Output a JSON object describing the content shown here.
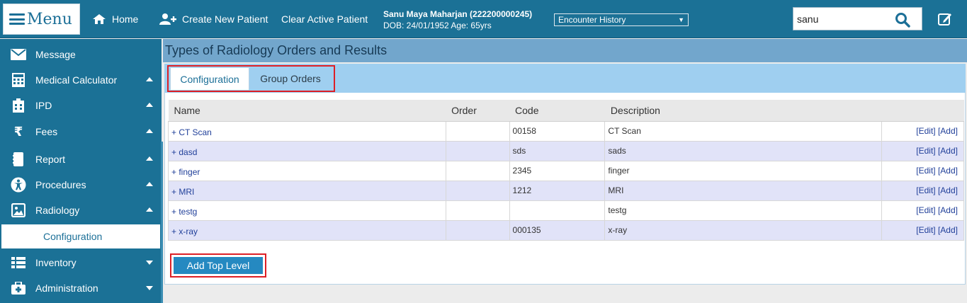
{
  "header": {
    "menu_label": "Menu",
    "nav": [
      {
        "label": "Home",
        "icon": "home-icon"
      },
      {
        "label": "Create New Patient",
        "icon": "add-user-icon"
      },
      {
        "label": "Clear Active Patient"
      }
    ],
    "patient_name": "Sanu Maya Maharjan (222200000245)",
    "patient_details": "DOB: 24/01/1952 Age: 65yrs",
    "encounter_select": "Encounter History",
    "search_value": "sanu"
  },
  "sidebar": {
    "items": [
      {
        "label": "Message",
        "icon": "envelope-icon"
      },
      {
        "label": "Medical Calculator",
        "icon": "calculator-icon"
      },
      {
        "label": "IPD",
        "icon": "hospital-icon"
      },
      {
        "label": "Fees",
        "icon": "rupee-icon"
      },
      {
        "label": "Report",
        "icon": "report-icon"
      },
      {
        "label": "Procedures",
        "icon": "accessibility-icon"
      },
      {
        "label": "Radiology",
        "icon": "image-icon"
      },
      {
        "label": "Inventory",
        "icon": "list-icon"
      },
      {
        "label": "Administration",
        "icon": "medkit-icon"
      }
    ],
    "active_sub_item": "Configuration"
  },
  "page": {
    "title": "Types of Radiology Orders and Results",
    "tabs": [
      "Configuration",
      "Group Orders"
    ],
    "active_tab": "Configuration"
  },
  "table": {
    "columns": [
      "Name",
      "Order",
      "Code",
      "Description",
      ""
    ],
    "rows": [
      {
        "name": "+ CT Scan",
        "order": "",
        "code": "00158",
        "description": "CT Scan",
        "edit": "[Edit]",
        "add": "[Add]"
      },
      {
        "name": "+ dasd",
        "order": "",
        "code": "sds",
        "description": "sads",
        "edit": "[Edit]",
        "add": "[Add]"
      },
      {
        "name": "+ finger",
        "order": "",
        "code": "2345",
        "description": "finger",
        "edit": "[Edit]",
        "add": "[Add]"
      },
      {
        "name": "+ MRI",
        "order": "",
        "code": "1212",
        "description": "MRI",
        "edit": "[Edit]",
        "add": "[Add]"
      },
      {
        "name": "+ testg",
        "order": "",
        "code": "",
        "description": "testg",
        "edit": "[Edit]",
        "add": "[Add]"
      },
      {
        "name": "+ x-ray",
        "order": "",
        "code": "000135",
        "description": "x-ray",
        "edit": "[Edit]",
        "add": "[Add]"
      }
    ]
  },
  "add_top_level_label": "Add Top Level",
  "colors": {
    "primary": "#1b7196",
    "page_header": "#72a6cc",
    "tab_bar": "#9fcff0",
    "row_alt": "#e1e3f8",
    "highlight_frame": "#dd1f26",
    "button": "#2589c1"
  }
}
